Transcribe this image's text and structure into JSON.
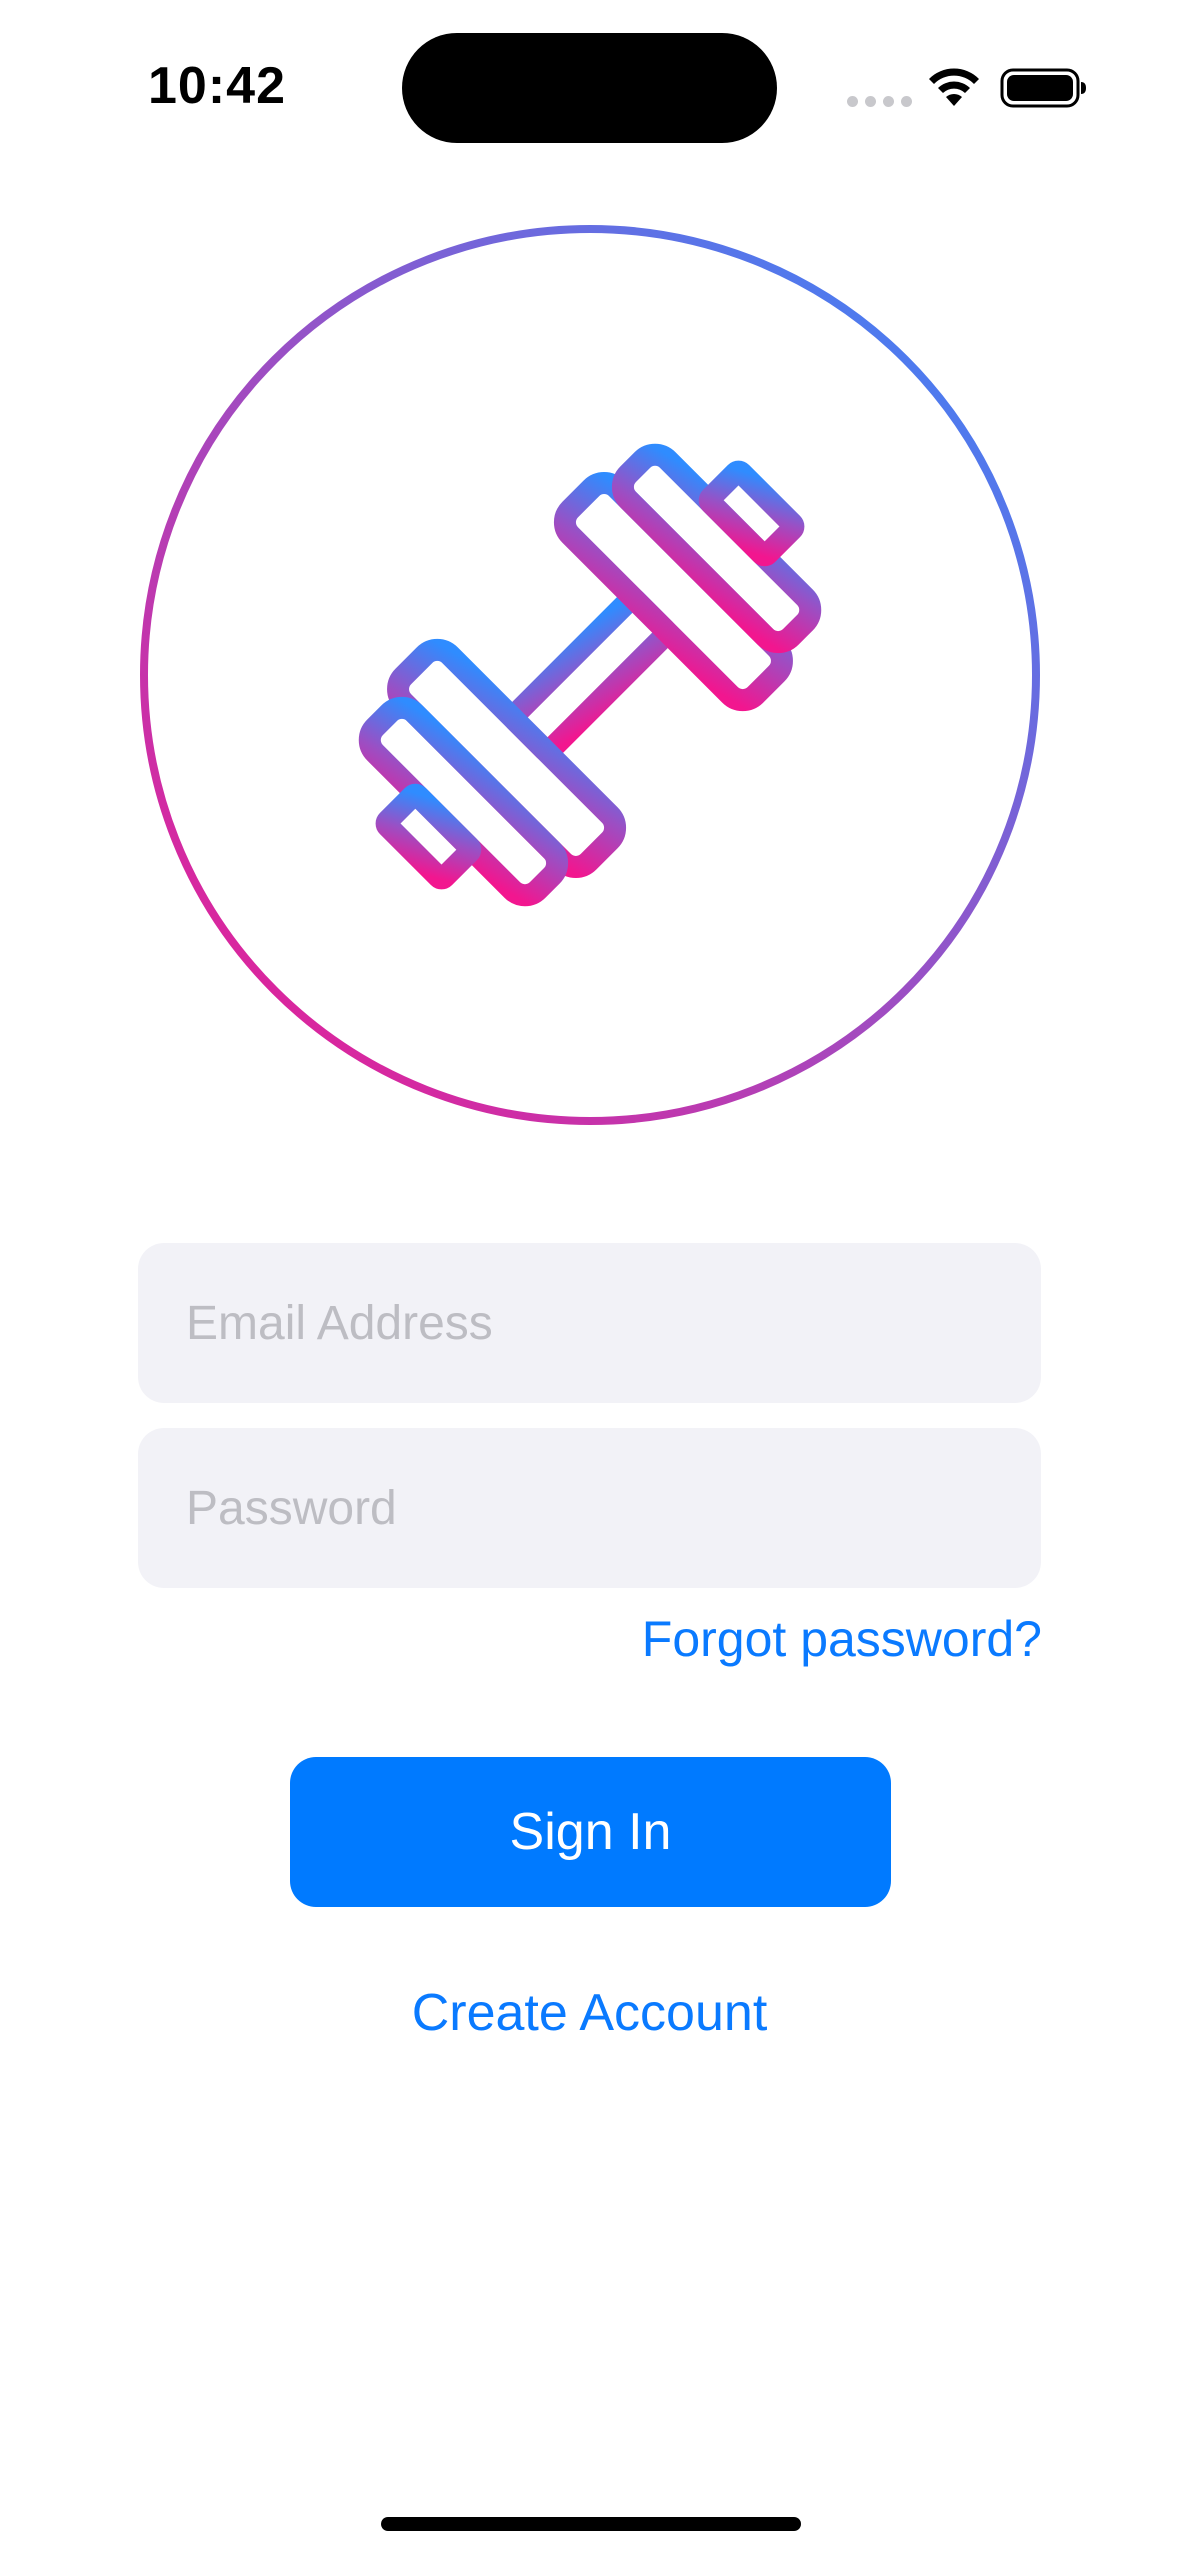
{
  "status_bar": {
    "time": "10:42"
  },
  "icons": {
    "logo": "dumbbell-icon",
    "wifi": "wifi-icon",
    "battery": "battery-icon",
    "signal": "cellular-signal-icon"
  },
  "colors": {
    "accent": "#007aff",
    "link": "#0a7aff",
    "field_background": "#f2f2f7",
    "placeholder": "#bdbdc3",
    "logo_gradient_start": "#f2168f",
    "logo_gradient_end": "#2f8cff"
  },
  "login_form": {
    "email_placeholder": "Email Address",
    "email_value": "",
    "password_placeholder": "Password",
    "password_value": "",
    "forgot_password_label": "Forgot password?",
    "sign_in_label": "Sign In",
    "create_account_label": "Create Account"
  }
}
